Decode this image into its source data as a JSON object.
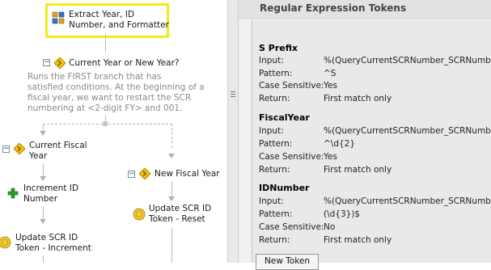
{
  "workflow": {
    "extract_node": {
      "label_line1": "Extract Year, ID",
      "label_line2": "Number, and Formatter"
    },
    "decision_node": {
      "expander": "−",
      "label": "Current Year or New Year?",
      "description": [
        "Runs the FIRST branch that has",
        "satisfied conditions. At the beginning of a",
        "fiscal year, we want to restart the SCR",
        "numbering at <2-digit FY> and 001."
      ]
    },
    "branch_current": {
      "expander": "−",
      "label_line1": "Current Fiscal",
      "label_line2": "Year"
    },
    "branch_new": {
      "expander": "−",
      "label": "New Fiscal Year"
    },
    "increment_node": {
      "label_line1": "Increment ID",
      "label_line2": "Number"
    },
    "update_reset_node": {
      "label_line1": "Update SCR ID",
      "label_line2": "Token - Reset"
    },
    "update_increment_node": {
      "label_line1": "Update SCR ID",
      "label_line2": "Token - Increment"
    }
  },
  "panel": {
    "title": "Regular Expression Tokens",
    "labels": {
      "input": "Input:",
      "pattern": "Pattern:",
      "case": "Case Sensitive:",
      "return": "Return:"
    },
    "tokens": [
      {
        "name": "S Prefix",
        "input": "%(QueryCurrentSCRNumber_SCRNumber)",
        "pattern": "^S",
        "case_sensitive": "Yes",
        "return": "First match only"
      },
      {
        "name": "FiscalYear",
        "input": "%(QueryCurrentSCRNumber_SCRNumber)",
        "pattern": "^\\d{2}",
        "case_sensitive": "Yes",
        "return": "First match only"
      },
      {
        "name": "IDNumber",
        "input": "%(QueryCurrentSCRNumber_SCRNumber)",
        "pattern": "(\\d{3})$",
        "case_sensitive": "No",
        "return": "First match only"
      }
    ],
    "new_token_button": "New Token"
  },
  "icons": [
    "activity-grid-icon",
    "decision-diamond-icon",
    "plus-icon",
    "token-coin-icon",
    "splitter-grip-icon"
  ]
}
